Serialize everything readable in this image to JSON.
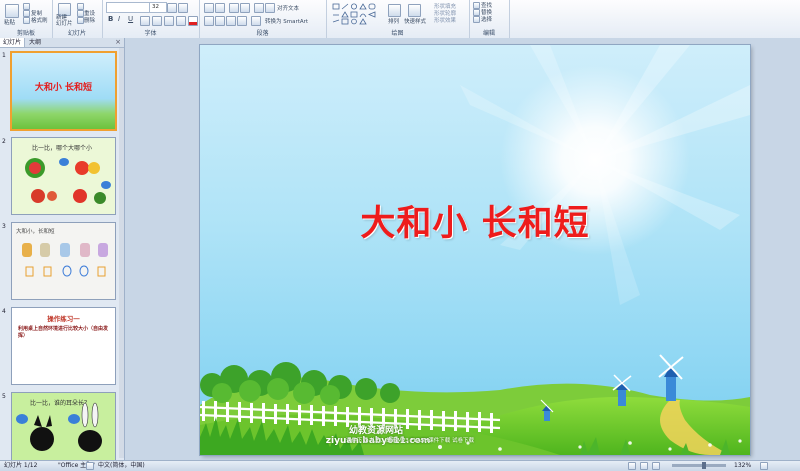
{
  "ribbon": {
    "clipboard": {
      "paste": "粘贴",
      "copy": "复制",
      "format_painter": "格式刷",
      "label": "剪贴板"
    },
    "slides": {
      "new_slide": "新建\n幻灯片",
      "reset": "重设",
      "delete": "删除",
      "label": "幻灯片"
    },
    "font": {
      "size": "32",
      "bold": "B",
      "italic": "I",
      "underline": "U",
      "label": "字体"
    },
    "paragraph": {
      "align_text": "对齐文本",
      "convert_smartart": "转换为 SmartArt",
      "label": "段落"
    },
    "drawing": {
      "arrange": "排列",
      "quick_styles": "快速样式",
      "shape_fill": "形状填充",
      "shape_outline": "形状轮廓",
      "shape_effects": "形状效果",
      "label": "绘图"
    },
    "editing": {
      "find": "查找",
      "replace": "替换",
      "select": "选择",
      "label": "编辑"
    }
  },
  "pane": {
    "tabs": [
      "幻灯片",
      "大纲"
    ],
    "close": "×",
    "slides": [
      {
        "num": "1",
        "title": "大和小  长和短"
      },
      {
        "num": "2",
        "title": "比一比，哪个大哪个小"
      },
      {
        "num": "3",
        "title": "大和小，长和短"
      },
      {
        "num": "4",
        "title": "操作练习一",
        "text": "利用桌上自然环境进行比较大小（自由发挥）"
      },
      {
        "num": "5",
        "title": "比一比，谁的耳朵长？"
      }
    ]
  },
  "slide": {
    "title": "大和小  长和短",
    "site_name": "幼教资源网站",
    "site_url": "ziyuan.baby611.com",
    "site_sub": "课件下载  儿歌、故事MP3  FLASH课件下载  试卷下载"
  },
  "status": {
    "slide_info": "幻灯片 1/12",
    "theme": "\"Office 主题\"",
    "language": "中文(简体，中国)",
    "zoom": "132%"
  },
  "colors": {
    "title_red": "#ee1c1c",
    "ribbon_bg": "#e5ecf5",
    "selection": "#f0a030"
  }
}
